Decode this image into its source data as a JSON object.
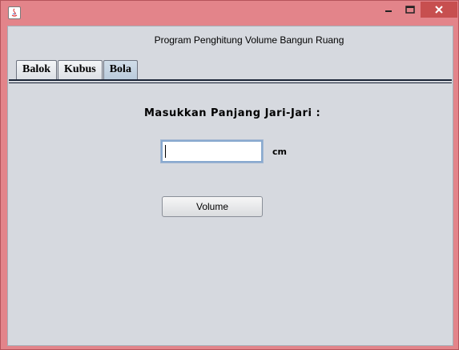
{
  "window": {
    "title": "",
    "icon": "java-icon",
    "controls": {
      "minimize": "minimize-icon",
      "maximize": "maximize-icon",
      "close": "close-icon"
    }
  },
  "header": {
    "program_title": "Program Penghitung Volume Bangun Ruang"
  },
  "tabs": [
    {
      "label": "Balok",
      "selected": false
    },
    {
      "label": "Kubus",
      "selected": false
    },
    {
      "label": "Bola",
      "selected": true
    }
  ],
  "form": {
    "prompt_label": "Masukkan Panjang Jari-Jari :",
    "radius_value": "",
    "unit_label": "cm",
    "volume_button_label": "Volume"
  },
  "colors": {
    "window_frame": "#e3848a",
    "close_button": "#c74f4f",
    "content_background": "#d6d9df",
    "selected_tab": "#c4d3e2",
    "input_focus_border": "#88a9cf"
  }
}
